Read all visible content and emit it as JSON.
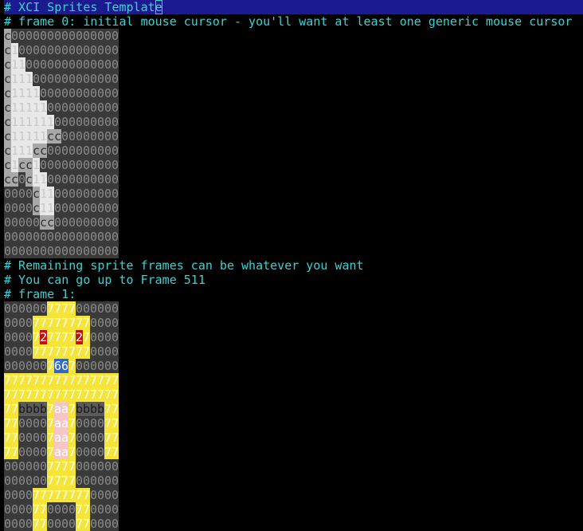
{
  "editor": {
    "title_comment": "# XCI Sprites Template",
    "frame0_comment": "# frame 0: initial mouse cursor - you'll want at least one generic mouse cursor",
    "remaining_comment": "# Remaining sprite frames can be whatever you want",
    "upto_comment": "# You can go up to Frame 511",
    "frame1_comment": "# frame 1:"
  },
  "colors": {
    "background": "#000000",
    "comment": "#3fd0d0",
    "selection": "#1b1b8f",
    "cell_0": "#3a3a3a",
    "cell_c": "#a8a8a8",
    "cell_1": "#e8e8e8",
    "cell_7": "#f5e53a",
    "cell_2": "#c01010",
    "cell_6": "#3468c0",
    "cell_b": "#5a5a5a",
    "cell_a": "#f6c6c6"
  },
  "frame0_rows": [
    "c000000000000000",
    "c100000000000000",
    "c110000000000000",
    "c111000000000000",
    "c111100000000000",
    "c111110000000000",
    "c111111000000000",
    "c11111cc00000000",
    "c111cc0000000000",
    "c1cc100000000000",
    "cc0c110000000000",
    "0000c11000000000",
    "0000c11000000000",
    "00000cc000000000",
    "0000000000000000",
    "0000000000000000"
  ],
  "frame1_rows": [
    "0000007777000000",
    "0000777777770000",
    "0000727777270000",
    "0000777777770000",
    "0000007667000000",
    "7777777777777777",
    "7777777777777777",
    "77bbbb7aa7bbbb77",
    "7700007aa7000077",
    "7700007aa7000077",
    "7700007aa7000077",
    "0000007777000000",
    "0000007777000000",
    "0000777777770000",
    "0000770000770000",
    "0000770000770000"
  ]
}
